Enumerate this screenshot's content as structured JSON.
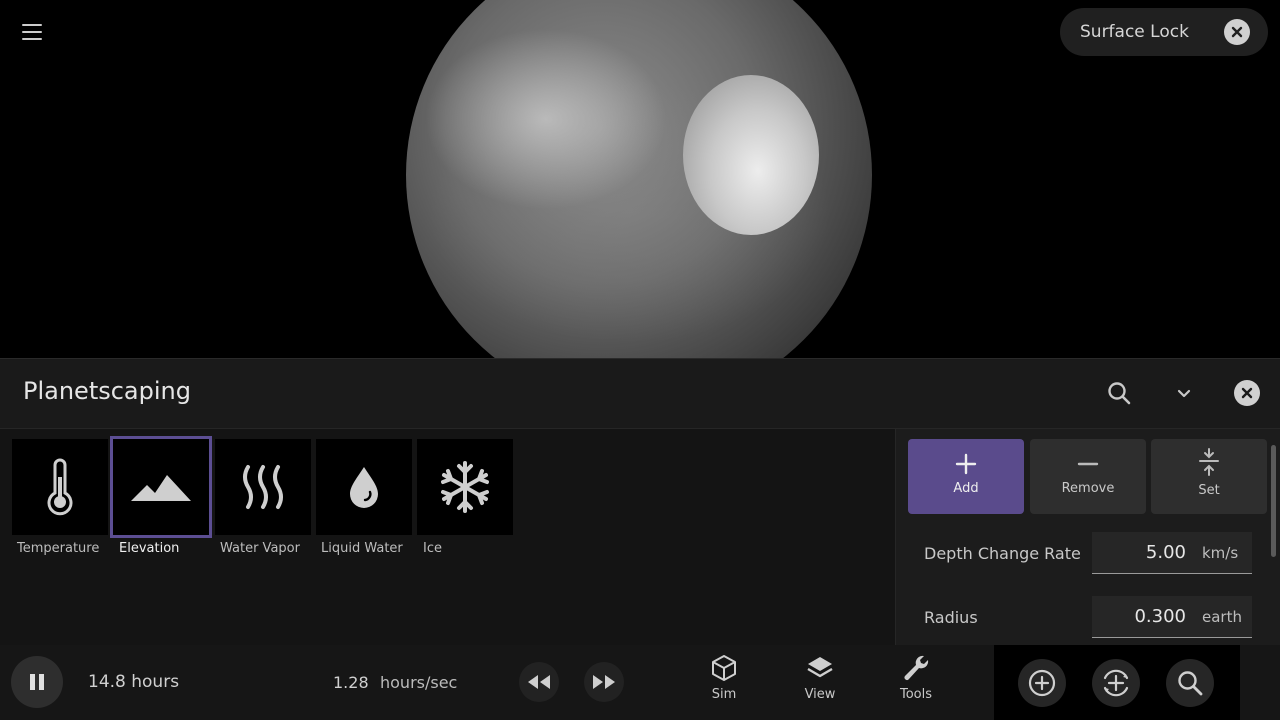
{
  "overlay": {
    "surface_lock_label": "Surface Lock"
  },
  "panel": {
    "title": "Planetscaping",
    "layers": [
      {
        "label": "Temperature",
        "icon": "thermometer-icon",
        "selected": false
      },
      {
        "label": "Elevation",
        "icon": "mountain-icon",
        "selected": true
      },
      {
        "label": "Water Vapor",
        "icon": "vapor-icon",
        "selected": false
      },
      {
        "label": "Liquid Water",
        "icon": "water-drop-icon",
        "selected": false
      },
      {
        "label": "Ice",
        "icon": "snowflake-icon",
        "selected": false
      }
    ],
    "modes": [
      {
        "label": "Add",
        "icon": "plus-icon",
        "active": true
      },
      {
        "label": "Remove",
        "icon": "minus-icon",
        "active": false
      },
      {
        "label": "Set",
        "icon": "set-level-icon",
        "active": false
      }
    ],
    "fields": [
      {
        "label": "Depth Change Rate",
        "value": "5.00",
        "unit": "km/s"
      },
      {
        "label": "Radius",
        "value": "0.300",
        "unit": "earth"
      }
    ]
  },
  "bottombar": {
    "elapsed": "14.8 hours",
    "rate_value": "1.28",
    "rate_unit": "hours/sec",
    "nav": [
      {
        "label": "Sim",
        "icon": "cube-icon"
      },
      {
        "label": "View",
        "icon": "layers-icon"
      },
      {
        "label": "Tools",
        "icon": "wrench-icon"
      }
    ]
  },
  "colors": {
    "accent": "#5a4b8c",
    "selected_border": "#5c4e93",
    "panel_bg": "#141414"
  }
}
